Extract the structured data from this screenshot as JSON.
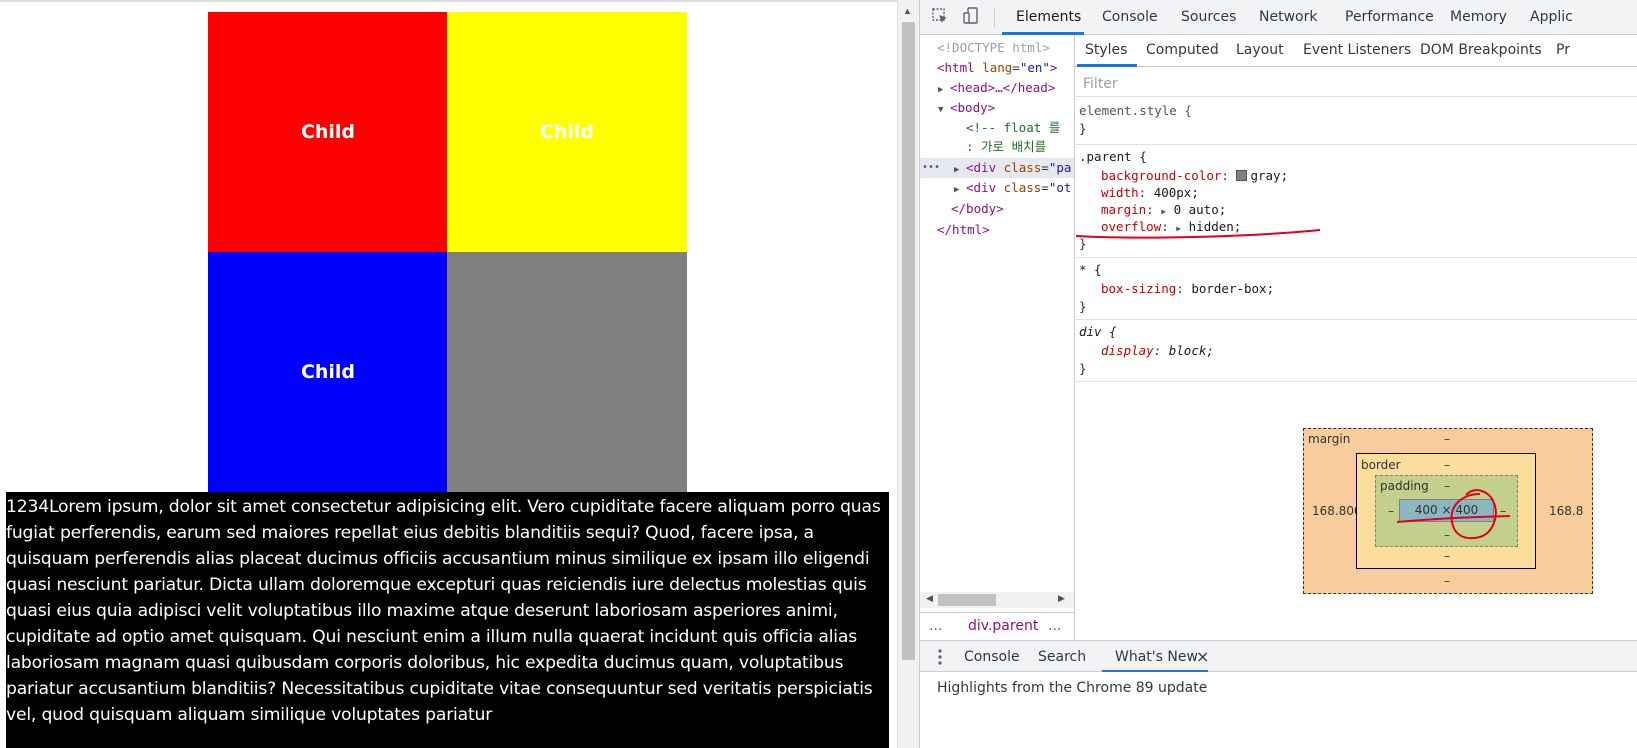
{
  "page": {
    "children": [
      "Child",
      "Child",
      "Child",
      ""
    ],
    "paragraph": "1234Lorem ipsum, dolor sit amet consectetur adipisicing elit. Vero cupiditate facere aliquam porro quas fugiat perferendis, earum sed maiores repellat eius debitis blanditiis sequi? Quod, facere ipsa, a quisquam perferendis alias placeat ducimus officiis accusantium minus similique ex ipsam illo eligendi quasi nesciunt pariatur. Dicta ullam doloremque excepturi quas reiciendis iure delectus molestias quis quasi eius quia adipisci velit voluptatibus illo maxime atque deserunt laboriosam asperiores animi, cupiditate ad optio amet quisquam. Qui nesciunt enim a illum nulla quaerat incidunt quis officia alias laboriosam magnam quasi quibusdam corporis doloribus, hic expedita ducimus quam, voluptatibus pariatur accusantium blanditiis? Necessitatibus cupiditate vitae consequuntur sed veritatis perspiciatis vel, quod quisquam aliquam similique voluptates pariatur"
  },
  "devtools": {
    "main_tabs": [
      "Elements",
      "Console",
      "Sources",
      "Network",
      "Performance",
      "Memory",
      "Applic"
    ],
    "active_tab": "Elements",
    "dom": {
      "doctype": "<!DOCTYPE html>",
      "html_open_tag": "<html",
      "html_lang_attr": "lang",
      "html_lang_val": "\"en\"",
      "gt": ">",
      "head": "<head>…</head>",
      "body_open": "<body>",
      "comment_line1": "<!-- float 를",
      "comment_line2": ": 가로 배치를",
      "ellipsis": "•••",
      "div_open": "<div",
      "class_attr": "class",
      "div1_class_val": "\"pa",
      "div2_class_val": "\"ot",
      "body_close": "</body>",
      "html_close": "</html>"
    },
    "breadcrumb": {
      "more_left": "...",
      "current": "div.parent",
      "more_right": "..."
    },
    "styles_tabs": [
      "Styles",
      "Computed",
      "Layout",
      "Event Listeners",
      "DOM Breakpoints",
      "Pr"
    ],
    "filter_placeholder": "Filter",
    "rules": {
      "element_style": {
        "selector": "element.style {",
        "close": "}"
      },
      "parent": {
        "selector": ".parent {",
        "p1_name": "background-color",
        "p1_val": "gray;",
        "p2_name": "width",
        "p2_val": "400px;",
        "p3_name": "margin",
        "p3_val": "0 auto;",
        "p4_name": "overflow",
        "p4_val": "hidden;",
        "close": "}"
      },
      "universal": {
        "selector": "* {",
        "p1_name": "box-sizing",
        "p1_val": "border-box;",
        "close": "}"
      },
      "div_rule": {
        "selector": "div {",
        "p1_name": "display",
        "p1_val": "block;",
        "close": "}"
      }
    },
    "box_model": {
      "margin_label": "margin",
      "border_label": "border",
      "padding_label": "padding",
      "dash": "–",
      "margin_left": "168.800",
      "margin_right": "168.8",
      "content": "400 × 400"
    },
    "drawer_tabs": [
      "Console",
      "Search",
      "What's New"
    ],
    "drawer_close": "×",
    "drawer_text": "Highlights from the Chrome 89 update",
    "colors": {
      "accent": "#1a73e8",
      "annotation": "#e0001b"
    }
  }
}
